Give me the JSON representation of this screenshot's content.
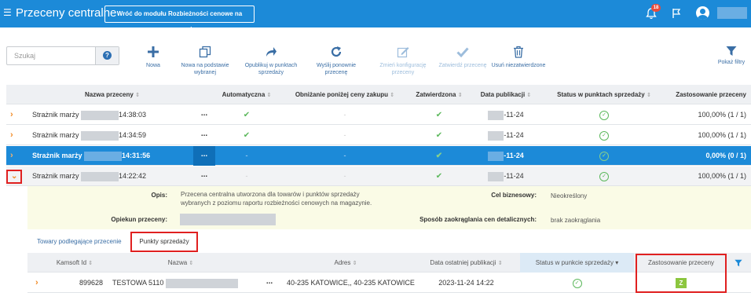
{
  "app": {
    "title": "Przeceny centralne",
    "back_button": "Wróć do modułu Rozbieżności cenowe na magazynie",
    "notifications_count": "18"
  },
  "colors": {
    "primary": "#1c8ad8",
    "accent": "#f18b26",
    "success": "#5cb85c",
    "highlight": "#e02020",
    "detail_bg": "#fafbe6"
  },
  "icons": [
    "menu-icon",
    "bell-icon",
    "flag-icon",
    "user-avatar-icon",
    "help-icon",
    "plus-icon",
    "copy-icon",
    "share-icon",
    "refresh-icon",
    "edit-icon",
    "check-icon",
    "trash-icon",
    "filter-icon",
    "chevron-right-icon",
    "chevron-down-icon",
    "check-circle-icon"
  ],
  "search": {
    "placeholder": "Szukaj",
    "help": "?"
  },
  "toolbar": {
    "new": "Nowa",
    "based_on_1": "Nowa na podstawie",
    "based_on_2": "wybranej",
    "publish_1": "Opublikuj w punktach",
    "publish_2": "sprzedaży",
    "resend_1": "Wyślij ponownie",
    "resend_2": "przecenę",
    "change_1": "Zmień konfigurację",
    "change_2": "przeceny",
    "approve": "Zatwierdź przecenę",
    "delete_unapproved": "Usuń niezatwierdzone",
    "filters": "Pokaż filtry"
  },
  "grid": {
    "columns": {
      "name": "Nazwa przeceny",
      "automatic": "Automatyczna",
      "below_purchase": "Obniżanie poniżej ceny zakupu",
      "approved": "Zatwierdzona",
      "pub_date": "Data publikacji",
      "status": "Status w punktach sprzedaży",
      "usage": "Zastosowanie przeceny"
    },
    "sort_glyph": "⇕",
    "rows": [
      {
        "name": "Strażnik marży",
        "time": "14:38:03",
        "dots": "...",
        "automatic": "✔",
        "below": "-",
        "approved": "✔",
        "date": "-11-24",
        "usage": "100,00% (1 / 1)"
      },
      {
        "name": "Strażnik marży",
        "time": "14:34:59",
        "dots": "...",
        "automatic": "✔",
        "below": "-",
        "approved": "✔",
        "date": "-11-24",
        "usage": "100,00% (1 / 1)"
      },
      {
        "name": "Strażnik marży",
        "time": "14:31:56",
        "dots": "...",
        "automatic": "-",
        "below": "-",
        "approved": "✔",
        "date": "-11-24",
        "usage": "0,00% (0 / 1)"
      },
      {
        "name": "Strażnik marży",
        "time": "14:22:42",
        "dots": "...",
        "automatic": "-",
        "below": "-",
        "approved": "✔",
        "date": "-11-24",
        "usage": "100,00% (1 / 1)"
      }
    ]
  },
  "detail": {
    "opis_label": "Opis:",
    "opis_line1": "Przecena centralna utworzona dla towarów i punktów sprzedaży",
    "opis_line2": "wybranych z poziomu raportu rozbieżności cenowych na magazynie.",
    "opiekun_label": "Opiekun przeceny:",
    "cel_label": "Cel biznesowy:",
    "cel_value": "Nieokreślony",
    "sposob_label": "Sposób zaokrąglania cen detalicznych:",
    "sposob_value": "brak zaokrąglania"
  },
  "subtabs": {
    "towary": "Towary podlegające przecenie",
    "punkty": "Punkty sprzedaży"
  },
  "subgrid": {
    "columns": {
      "kamsoft_id": "Kamsoft Id",
      "nazwa": "Nazwa",
      "adres": "Adres",
      "data_pub": "Data ostatniej publikacji",
      "status": "Status w punkcie sprzedaży",
      "zastosowanie": "Zastosowanie przeceny"
    },
    "sort_down": "▾",
    "rows": [
      {
        "id": "899628",
        "nazwa": "TESTOWA 5110",
        "dots": "...",
        "adres": "40-235 KATOWICE,, 40-235 KATOWICE",
        "data": "2023-11-24 14:22",
        "zast": "Z"
      }
    ]
  }
}
